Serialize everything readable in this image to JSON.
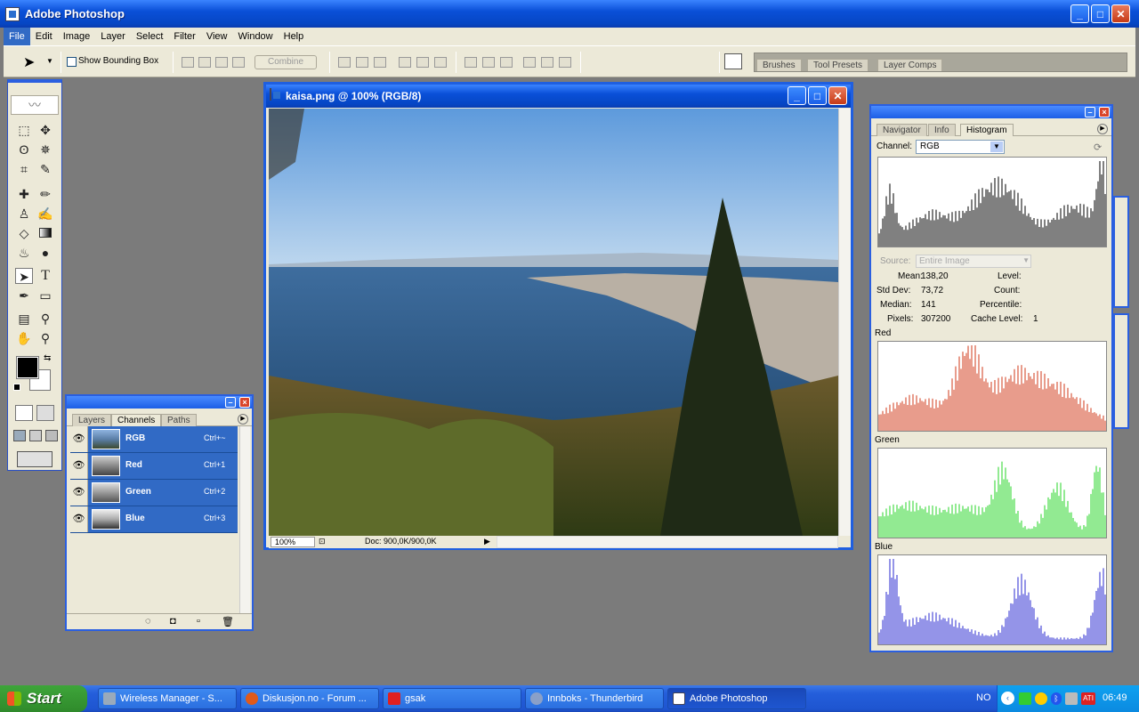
{
  "app": {
    "title": "Adobe Photoshop"
  },
  "menu": [
    "File",
    "Edit",
    "Image",
    "Layer",
    "Select",
    "Filter",
    "View",
    "Window",
    "Help"
  ],
  "options": {
    "show_bounding_box": "Show Bounding Box",
    "combine": "Combine"
  },
  "palette_well": {
    "tabs": [
      "Brushes",
      "Tool Presets",
      "Layer Comps"
    ]
  },
  "document": {
    "title": "kaisa.png @ 100% (RGB/8)",
    "zoom": "100%",
    "doc_size": "Doc: 900,0K/900,0K"
  },
  "channels_palette": {
    "tabs": [
      "Layers",
      "Channels",
      "Paths"
    ],
    "active_tab": "Channels",
    "rows": [
      {
        "name": "RGB",
        "shortcut": "Ctrl+~"
      },
      {
        "name": "Red",
        "shortcut": "Ctrl+1"
      },
      {
        "name": "Green",
        "shortcut": "Ctrl+2"
      },
      {
        "name": "Blue",
        "shortcut": "Ctrl+3"
      }
    ]
  },
  "histogram_palette": {
    "tabs": [
      "Navigator",
      "Info",
      "Histogram"
    ],
    "active_tab": "Histogram",
    "channel_label": "Channel:",
    "channel_value": "RGB",
    "source_label": "Source:",
    "source_value": "Entire Image",
    "stats": {
      "mean_label": "Mean:",
      "mean": "138,20",
      "stddev_label": "Std Dev:",
      "stddev": "73,72",
      "median_label": "Median:",
      "median": "141",
      "pixels_label": "Pixels:",
      "pixels": "307200",
      "level_label": "Level:",
      "count_label": "Count:",
      "percentile_label": "Percentile:",
      "cache_label": "Cache Level:",
      "cache": "1"
    },
    "channels": [
      "Red",
      "Green",
      "Blue"
    ],
    "colors": {
      "rgb": "#000000",
      "red": "#d23a1a",
      "green": "#26d626",
      "blue": "#2a2ad0"
    }
  },
  "taskbar": {
    "start": "Start",
    "items": [
      {
        "label": "Wireless Manager - S..."
      },
      {
        "label": "Diskusjon.no - Forum ..."
      },
      {
        "label": "gsak"
      },
      {
        "label": "Innboks - Thunderbird"
      },
      {
        "label": "Adobe Photoshop"
      }
    ],
    "lang": "NO",
    "clock": "06:49"
  }
}
